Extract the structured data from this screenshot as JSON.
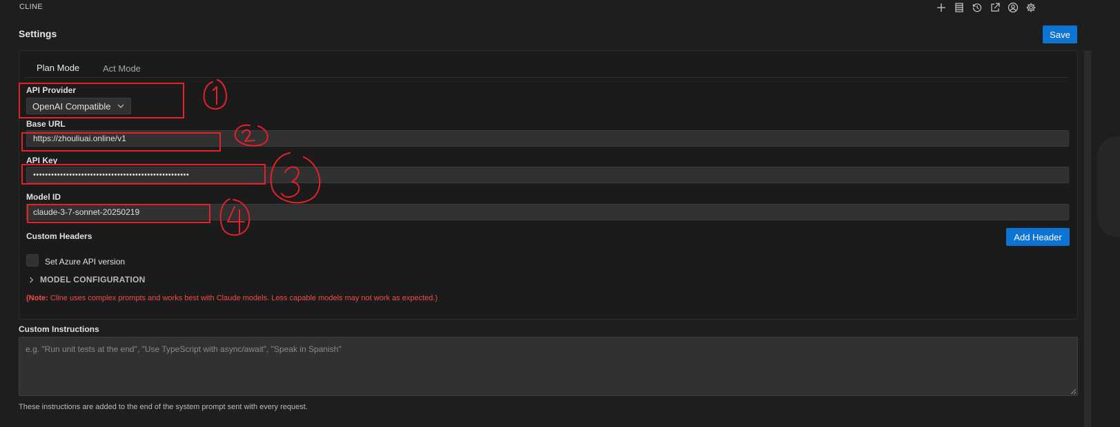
{
  "app": {
    "title": "CLINE"
  },
  "header_icons": [
    "plus-icon",
    "database-icon",
    "history-icon",
    "external-link-icon",
    "account-icon",
    "gear-icon"
  ],
  "settings": {
    "title": "Settings",
    "save_label": "Save"
  },
  "tabs": [
    {
      "label": "Plan Mode",
      "active": true
    },
    {
      "label": "Act Mode",
      "active": false
    }
  ],
  "form": {
    "api_provider": {
      "label": "API Provider",
      "value": "OpenAI Compatible"
    },
    "base_url": {
      "label": "Base URL",
      "value": "https://zhouliuai.online/v1"
    },
    "api_key": {
      "label": "API Key",
      "value": "••••••••••••••••••••••••••••••••••••••••••••••••••••"
    },
    "model_id": {
      "label": "Model ID",
      "value": "claude-3-7-sonnet-20250219"
    },
    "custom_headers": {
      "label": "Custom Headers",
      "add_label": "Add Header"
    },
    "azure": {
      "label": "Set Azure API version",
      "checked": false
    },
    "model_configuration": {
      "label": "MODEL CONFIGURATION",
      "expanded": false
    },
    "note": {
      "prefix": "(Note:",
      "text": " Cline uses complex prompts and works best with Claude models. Less capable models may not work as expected.)"
    }
  },
  "custom_instructions": {
    "label": "Custom Instructions",
    "placeholder": "e.g. \"Run unit tests at the end\", \"Use TypeScript with async/await\", \"Speak in Spanish\"",
    "helper": "These instructions are added to the end of the system prompt sent with every request."
  },
  "colors": {
    "accent": "#0e74d4",
    "annotation": "#e8202a",
    "warning": "#f14c4c"
  }
}
